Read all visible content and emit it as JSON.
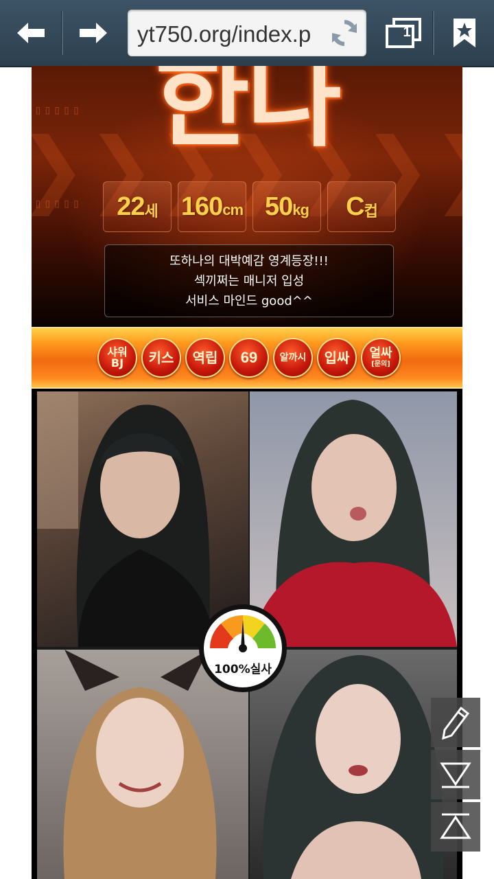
{
  "browser": {
    "url": "yt750.org/index.p",
    "tab_count": "1"
  },
  "banner": {
    "name": "한나",
    "stats": [
      {
        "num": "22",
        "unit": "세"
      },
      {
        "num": "160",
        "unit": "cm"
      },
      {
        "num": "50",
        "unit": "kg"
      },
      {
        "num": "C",
        "unit": "컵"
      }
    ],
    "description": [
      "또하나의 대박예감 영계등장!!!",
      "섹끼쩌는 매니저 입성",
      "서비스 마인드 good^^"
    ]
  },
  "services": [
    {
      "top": "샤워",
      "bottom": "BJ"
    },
    {
      "top": "키스",
      "bottom": ""
    },
    {
      "top": "역립",
      "bottom": ""
    },
    {
      "top": "69",
      "bottom": ""
    },
    {
      "top": "알까시",
      "bottom": ""
    },
    {
      "top": "입싸",
      "bottom": ""
    },
    {
      "top": "얼싸",
      "bottom": "[문의]"
    }
  ],
  "gauge": {
    "label": "100%실사",
    "level": 0.5
  },
  "colors": {
    "toolbar": "#34495a",
    "accent_orange": "#f26a10",
    "stat_text": "#ffd04a"
  },
  "icons": [
    "back-arrow-icon",
    "forward-arrow-icon",
    "reload-icon",
    "tabs-icon",
    "bookmark-star-icon",
    "pencil-icon",
    "scroll-down-icon",
    "scroll-top-icon"
  ]
}
